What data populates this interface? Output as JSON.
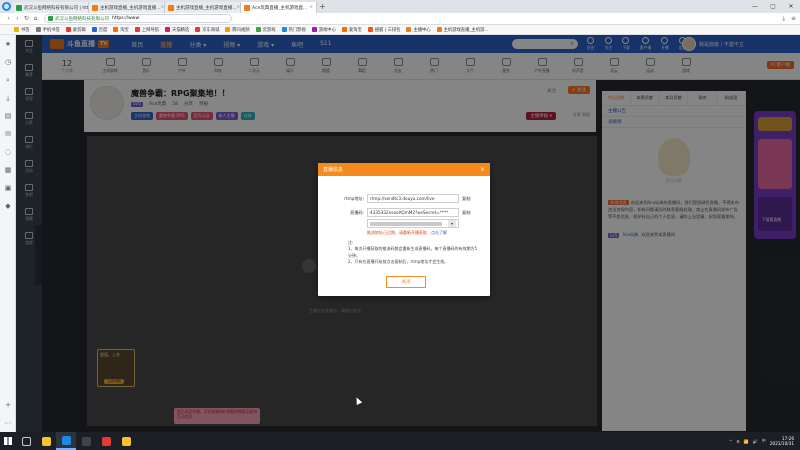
{
  "browser": {
    "tabs": [
      {
        "label": "武汉斗鱼网络科技有限公司 | https://www",
        "active": false,
        "color": "#2e9d4a"
      },
      {
        "label": "主机游戏直播_主机游戏直播...",
        "active": false,
        "color": "#f27c14"
      },
      {
        "label": "主机游戏直播_主机游戏直播...",
        "active": false,
        "color": "#f27c14"
      },
      {
        "label": "Ace玩典直播_主机游戏直...",
        "active": true,
        "color": "#f27c14"
      }
    ],
    "url_host": "武汉斗鱼网络科技有限公司",
    "url_proto": "https://www",
    "bookmarks": [
      {
        "label": "书签",
        "color": "#f4b400"
      },
      {
        "label": "手机书签",
        "color": "#7b7b7b"
      },
      {
        "label": "爱剪辑",
        "color": "#e53935"
      },
      {
        "label": "百度",
        "color": "#2b63d6"
      },
      {
        "label": "淘宝",
        "color": "#ff6a00"
      },
      {
        "label": "上网导航",
        "color": "#e53935"
      },
      {
        "label": "天猫精选",
        "color": "#d81b60"
      },
      {
        "label": "京东商城",
        "color": "#e53935"
      },
      {
        "label": "腾讯视频",
        "color": "#ff9800"
      },
      {
        "label": "云游戏",
        "color": "#43a047"
      },
      {
        "label": "热门影视",
        "color": "#1e88e5"
      },
      {
        "label": "游戏中心",
        "color": "#8e24aa"
      },
      {
        "label": "爱淘宝",
        "color": "#ff6a00"
      },
      {
        "label": "搜狐 | 三排包",
        "color": "#f4511e"
      },
      {
        "label": "主播中心",
        "color": "#f27c14"
      },
      {
        "label": "主机游戏直播_主机游...",
        "color": "#f27c14"
      }
    ]
  },
  "site": {
    "logo_text": "斗鱼直播",
    "logo_badge": "TV",
    "nav": [
      {
        "label": "首页",
        "on": false
      },
      {
        "label": "直播",
        "on": true
      },
      {
        "label": "分类 ▾",
        "on": false
      },
      {
        "label": "视频 ▾",
        "on": false
      },
      {
        "label": "游戏 ▾",
        "on": false
      },
      {
        "label": "鱼吧",
        "on": false
      },
      {
        "label": "S11",
        "on": false
      }
    ],
    "header_icons": [
      "历史",
      "关注",
      "下载",
      "客户端",
      "开播",
      "定位"
    ],
    "user_name": "我是鼎级 / 不建不立",
    "left_bar": [
      "关注",
      "推荐",
      "发现",
      "分类",
      "排行",
      "活动",
      "鱼吧",
      "直播",
      "游戏"
    ],
    "cat_count": "12",
    "cat_count_unit": "个分类",
    "categories": [
      "主机游戏",
      "音乐",
      "户外",
      "科技",
      "二次元",
      "娱乐",
      "颜值",
      "舞蹈",
      "交友",
      "热门",
      "大厅",
      "星秀",
      "户外直播",
      "好声音",
      "风云",
      "运动",
      "游戏"
    ],
    "pc_button": "PC客户端"
  },
  "room": {
    "title": "魔兽争霸：RPG聚集地！！",
    "anchor_name": "Ace玩典",
    "level": "LV5",
    "stats": [
      "58",
      "分享",
      "举报"
    ],
    "tags": [
      {
        "label": "主机游戏",
        "color": "#2d62c9"
      },
      {
        "label": "魔兽争霸 RPG",
        "color": "#e94e77"
      },
      {
        "label": "官方认证",
        "color": "#e94e77"
      },
      {
        "label": "新人主播",
        "color": "#7b5cd6"
      },
      {
        "label": "在线",
        "color": "#2bb3c0"
      }
    ],
    "watch_count": "关注",
    "follow_label": "+ 关注",
    "report_label": "主播举报 ▾",
    "share_label": "分享 举报"
  },
  "player": {
    "hint": "主播正在准备中，请稍后尝试",
    "promo_title": "超值、上车",
    "promo_button": "立即领取"
  },
  "rightcol": {
    "tabs": [
      "今日贡献",
      "本周贡献",
      "本月贡献",
      "贵宾",
      "粉丝团"
    ],
    "head1": "主播公告",
    "head2": "贡献榜",
    "mascot_caption": "暂无贡献",
    "notice_tag": "系统消息",
    "notice": "欢迎来到Ace玩典的直播间，我们提倡绿色直播，不得发布违法违规内容，如有问题请及时联系客服处理，禁止在直播间发布广告等不良信息，保护好自己的个人信息，谨防上当受骗，祝您观看愉快。",
    "msg_level": "LV5",
    "msg_name": "Ace玩典",
    "msg_text": "欢迎来到本直播间"
  },
  "ad": {
    "label": "下载看直播"
  },
  "toast": {
    "text": "您已成功开播，可在直播间右侧看到弹幕及观众互动信息",
    "close": "×"
  },
  "dialog": {
    "title": "直播信息",
    "close": "×",
    "rtmp_label": "rtmp地址:",
    "rtmp_value": "rtmp://sendtc3.douyu.com/live",
    "copy1": "复制",
    "code_label": "直播码:",
    "code_value": "4335332nsooAQmM2?wsSecret=****",
    "copy2": "复制",
    "warn": "推流地址已过期，请重新开播获取",
    "warn_link": "点击了解",
    "notes_title": "注:",
    "note1": "1、每次开播获取的推流码都会重新生成直播码，每个直播码的有效期为5分钟。",
    "note2": "2、只有在直播开始前点击复制后，rtmp地址才会生效。",
    "close_button": "关闭"
  },
  "taskbar": {
    "time": "17:26",
    "date": "2021/10/31",
    "apps": [
      {
        "name": "explorer",
        "color": "#f4c430",
        "active": false
      },
      {
        "name": "browser-360",
        "color": "#1e88e5",
        "active": true
      },
      {
        "name": "obs",
        "color": "#444",
        "active": false
      },
      {
        "name": "netease",
        "color": "#e53935",
        "active": false
      },
      {
        "name": "app-yellow",
        "color": "#fbc02d",
        "active": false
      }
    ],
    "tray": [
      "^",
      "⚙",
      "📶",
      "🔊",
      "中"
    ]
  }
}
